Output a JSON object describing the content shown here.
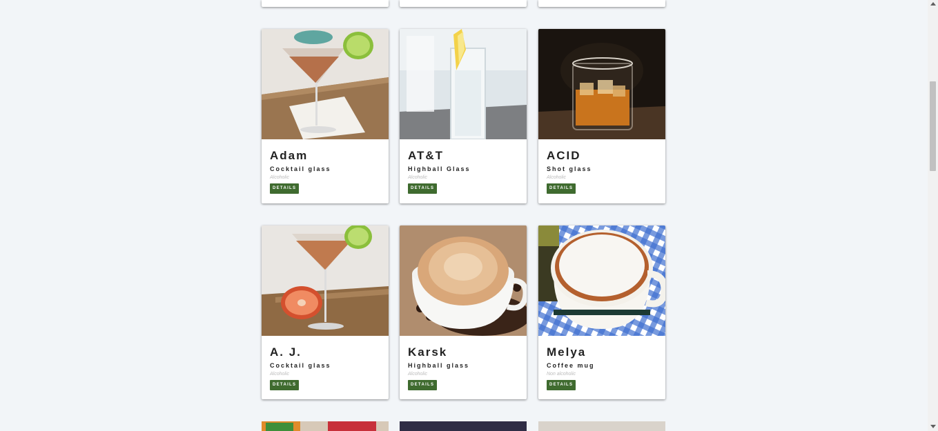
{
  "button_label": "DETAILS",
  "cards": [
    {
      "name": "Adam",
      "glass": "Cocktail glass",
      "alcoholic": "Alcoholic",
      "image": "martini-drink-image"
    },
    {
      "name": "AT&T",
      "glass": "Highball Glass",
      "alcoholic": "Alcoholic",
      "image": "highball-drink-image"
    },
    {
      "name": "ACID",
      "glass": "Shot glass",
      "alcoholic": "Alcoholic",
      "image": "whiskey-rocks-image"
    },
    {
      "name": "A. J.",
      "glass": "Cocktail glass",
      "alcoholic": "Alcoholic",
      "image": "grapefruit-martini-image"
    },
    {
      "name": "Karsk",
      "glass": "Highball glass",
      "alcoholic": "Alcoholic",
      "image": "coffee-cup-image"
    },
    {
      "name": "Melya",
      "glass": "Coffee mug",
      "alcoholic": "Non alcoholic",
      "image": "coffee-mug-image"
    }
  ],
  "colors": {
    "background": "#f2f5f8",
    "button": "#3f6b2f"
  }
}
